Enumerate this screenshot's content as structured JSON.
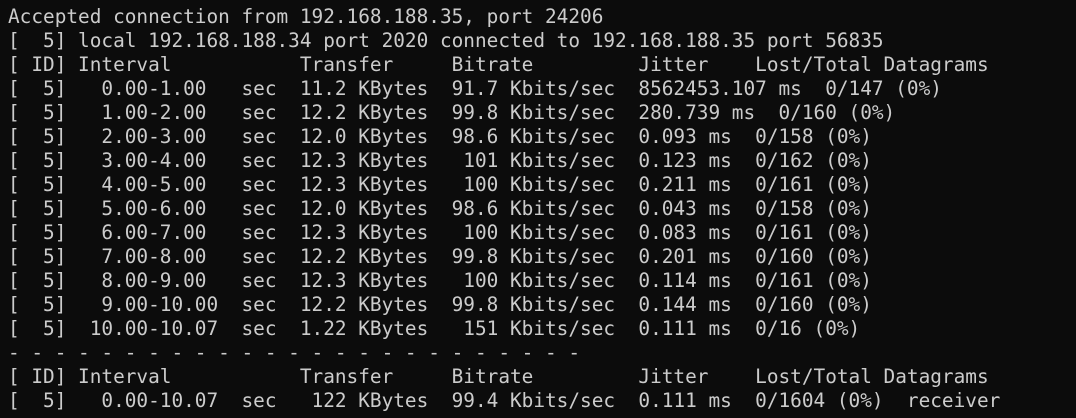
{
  "terminal": {
    "lines": [
      "Accepted connection from 192.168.188.35, port 24206",
      "[  5] local 192.168.188.34 port 2020 connected to 192.168.188.35 port 56835",
      "[ ID] Interval           Transfer     Bitrate         Jitter    Lost/Total Datagrams",
      "[  5]   0.00-1.00   sec  11.2 KBytes  91.7 Kbits/sec  8562453.107 ms  0/147 (0%)",
      "[  5]   1.00-2.00   sec  12.2 KBytes  99.8 Kbits/sec  280.739 ms  0/160 (0%)",
      "[  5]   2.00-3.00   sec  12.0 KBytes  98.6 Kbits/sec  0.093 ms  0/158 (0%)",
      "[  5]   3.00-4.00   sec  12.3 KBytes   101 Kbits/sec  0.123 ms  0/162 (0%)",
      "[  5]   4.00-5.00   sec  12.3 KBytes   100 Kbits/sec  0.211 ms  0/161 (0%)",
      "[  5]   5.00-6.00   sec  12.0 KBytes  98.6 Kbits/sec  0.043 ms  0/158 (0%)",
      "[  5]   6.00-7.00   sec  12.3 KBytes   100 Kbits/sec  0.083 ms  0/161 (0%)",
      "[  5]   7.00-8.00   sec  12.2 KBytes  99.8 Kbits/sec  0.201 ms  0/160 (0%)",
      "[  5]   8.00-9.00   sec  12.3 KBytes   100 Kbits/sec  0.114 ms  0/161 (0%)",
      "[  5]   9.00-10.00  sec  12.2 KBytes  99.8 Kbits/sec  0.144 ms  0/160 (0%)",
      "[  5]  10.00-10.07  sec  1.22 KBytes   151 Kbits/sec  0.111 ms  0/16 (0%)",
      "- - - - - - - - - - - - - - - - - - - - - - - - -",
      "[ ID] Interval           Transfer     Bitrate         Jitter    Lost/Total Datagrams",
      "[  5]   0.00-10.07  sec   122 KBytes  99.4 Kbits/sec  0.111 ms  0/1604 (0%)  receiver"
    ]
  },
  "colors": {
    "background": "#0c0c0c",
    "text": "#cccccc"
  }
}
